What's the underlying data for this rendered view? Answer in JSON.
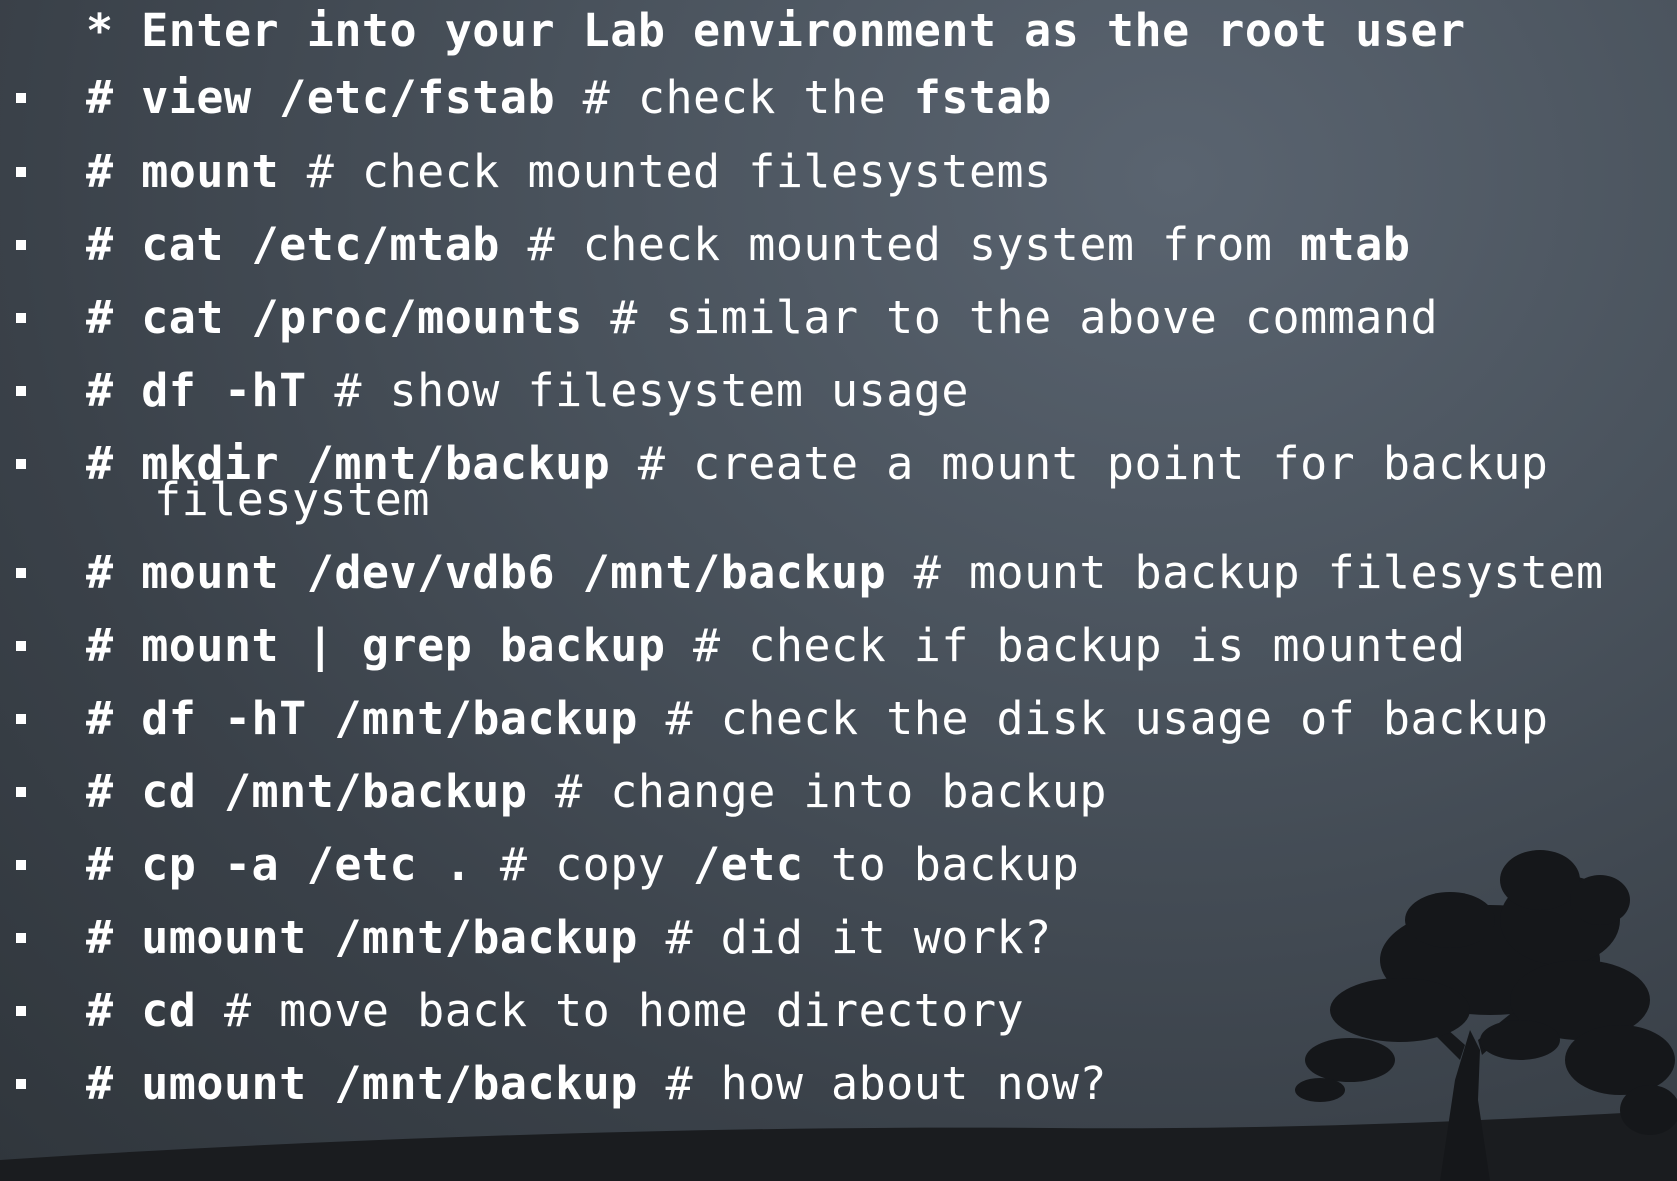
{
  "heading": "* Enter into your Lab environment as the root user",
  "commands": [
    {
      "parts": [
        {
          "t": "# ",
          "b": true
        },
        {
          "t": "view /etc/fstab",
          "b": true
        },
        {
          "t": " # check the ",
          "b": false
        },
        {
          "t": "fstab",
          "b": true
        }
      ]
    },
    {
      "parts": [
        {
          "t": "# ",
          "b": true
        },
        {
          "t": "mount",
          "b": true
        },
        {
          "t": " # check mounted filesystems",
          "b": false
        }
      ]
    },
    {
      "parts": [
        {
          "t": "# ",
          "b": true
        },
        {
          "t": "cat /etc/mtab",
          "b": true
        },
        {
          "t": " # check mounted system from ",
          "b": false
        },
        {
          "t": "mtab",
          "b": true
        }
      ]
    },
    {
      "parts": [
        {
          "t": "# ",
          "b": true
        },
        {
          "t": "cat /proc/mounts",
          "b": true
        },
        {
          "t": " # similar to the above command",
          "b": false
        }
      ]
    },
    {
      "parts": [
        {
          "t": "# ",
          "b": true
        },
        {
          "t": "df -hT",
          "b": true
        },
        {
          "t": " # show filesystem usage",
          "b": false
        }
      ]
    },
    {
      "parts": [
        {
          "t": "# ",
          "b": true
        },
        {
          "t": "mkdir /mnt/backup",
          "b": true
        },
        {
          "t": " # create a mount point for backup",
          "b": false
        }
      ],
      "continuation": "filesystem"
    },
    {
      "parts": [
        {
          "t": "# ",
          "b": true
        },
        {
          "t": "mount /dev/vdb6 /mnt/backup",
          "b": true
        },
        {
          "t": " # mount backup filesystem",
          "b": false
        }
      ]
    },
    {
      "parts": [
        {
          "t": "# ",
          "b": true
        },
        {
          "t": "mount | grep backup",
          "b": true
        },
        {
          "t": " # check if backup is mounted",
          "b": false
        }
      ]
    },
    {
      "parts": [
        {
          "t": "# ",
          "b": true
        },
        {
          "t": "df -hT /mnt/backup",
          "b": true
        },
        {
          "t": " # check the disk usage of backup",
          "b": false
        }
      ]
    },
    {
      "parts": [
        {
          "t": "# ",
          "b": true
        },
        {
          "t": "cd /mnt/backup",
          "b": true
        },
        {
          "t": " # change into backup",
          "b": false
        }
      ]
    },
    {
      "parts": [
        {
          "t": "# ",
          "b": true
        },
        {
          "t": "cp -a /etc .",
          "b": true
        },
        {
          "t": " # copy ",
          "b": false
        },
        {
          "t": "/etc",
          "b": true
        },
        {
          "t": " to backup",
          "b": false
        }
      ]
    },
    {
      "parts": [
        {
          "t": "# ",
          "b": true
        },
        {
          "t": "umount /mnt/backup",
          "b": true
        },
        {
          "t": " # did it work?",
          "b": false
        }
      ]
    },
    {
      "parts": [
        {
          "t": "# ",
          "b": true
        },
        {
          "t": "cd",
          "b": true
        },
        {
          "t": " # move back to home directory",
          "b": false
        }
      ]
    },
    {
      "parts": [
        {
          "t": "# ",
          "b": true
        },
        {
          "t": "umount /mnt/backup",
          "b": true
        },
        {
          "t": " # how about now?",
          "b": false
        }
      ]
    }
  ]
}
